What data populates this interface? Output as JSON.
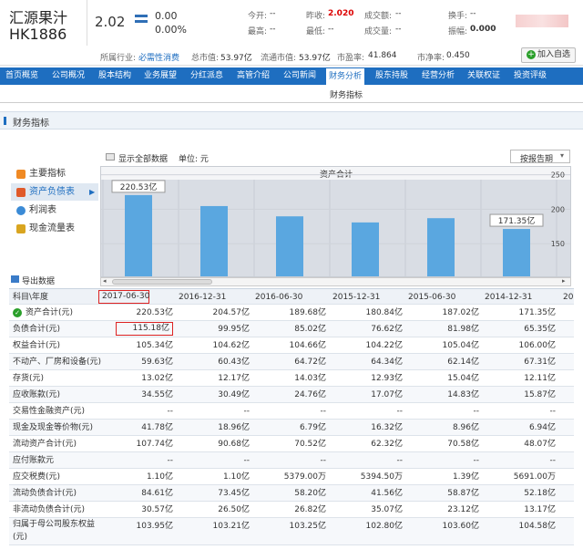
{
  "stock": {
    "name": "汇源果汁",
    "code": "HK1886",
    "price": "2.02",
    "change": "0.00",
    "change_pct": "0.00%"
  },
  "quote": [
    {
      "label": "今开:",
      "value": "--"
    },
    {
      "label": "昨收:",
      "value": "2.020"
    },
    {
      "label": "成交额:",
      "value": "--"
    },
    {
      "label": "换手:",
      "value": "--"
    },
    {
      "label": "最高:",
      "value": "--"
    },
    {
      "label": "最低:",
      "value": "--"
    },
    {
      "label": "成交量:",
      "value": "--"
    },
    {
      "label": "振幅:",
      "value": "0.000"
    }
  ],
  "sub": [
    {
      "label": "所属行业:",
      "value": "必需性消费"
    },
    {
      "label": "总市值:",
      "value": "53.97亿"
    },
    {
      "label": "流通市值:",
      "value": "53.97亿"
    },
    {
      "label": "市盈率:",
      "value": "41.864"
    },
    {
      "label": "市净率:",
      "value": "0.450"
    }
  ],
  "add_button": "加入自选",
  "nav": [
    "首页概览",
    "公司概况",
    "股本结构",
    "业务展望",
    "分红派息",
    "高管介绍",
    "公司新闻",
    "财务分析",
    "股东持股",
    "经营分析",
    "关联权证",
    "投资评级"
  ],
  "subnav": "财务指标",
  "section_title": "财务指标",
  "toolbar": {
    "show_all": "显示全部数据",
    "unit": "单位: 元",
    "period_select": "按报告期"
  },
  "left_menu": [
    "主要指标",
    "资产负债表",
    "利润表",
    "现金流量表"
  ],
  "export": "导出数据",
  "chart_data": {
    "type": "bar",
    "title": "资产合计",
    "categories": [
      "2017-06-30",
      "2016-12-31",
      "2016-06-30",
      "2015-12-31",
      "2015-06-30",
      "2014-12-31"
    ],
    "values": [
      220.53,
      204.57,
      189.68,
      180.84,
      187.02,
      171.35
    ],
    "labels": [
      "220.53亿",
      "",
      "",
      "",
      "",
      "171.35亿"
    ],
    "yticks": [
      "250",
      "200",
      "150"
    ],
    "ylim": [
      100,
      260
    ],
    "color": "#5aa7e0"
  },
  "table": {
    "header": [
      "科目\\年度",
      "2017-06-30",
      "2016-12-31",
      "2016-06-30",
      "2015-12-31",
      "2015-06-30",
      "2014-12-31",
      "20"
    ],
    "rows": [
      [
        "资产合计(元)",
        "220.53亿",
        "204.57亿",
        "189.68亿",
        "180.84亿",
        "187.02亿",
        "171.35亿"
      ],
      [
        "负债合计(元)",
        "115.18亿",
        "99.95亿",
        "85.02亿",
        "76.62亿",
        "81.98亿",
        "65.35亿"
      ],
      [
        "权益合计(元)",
        "105.34亿",
        "104.62亿",
        "104.66亿",
        "104.22亿",
        "105.04亿",
        "106.00亿"
      ],
      [
        "不动产、厂房和设备(元)",
        "59.63亿",
        "60.43亿",
        "64.72亿",
        "64.34亿",
        "62.14亿",
        "67.31亿"
      ],
      [
        "存货(元)",
        "13.02亿",
        "12.17亿",
        "14.03亿",
        "12.93亿",
        "15.04亿",
        "12.11亿"
      ],
      [
        "应收账款(元)",
        "34.55亿",
        "30.49亿",
        "24.76亿",
        "17.07亿",
        "14.83亿",
        "15.87亿"
      ],
      [
        "交易性金融资产(元)",
        "--",
        "--",
        "--",
        "--",
        "--",
        "--"
      ],
      [
        "现金及现金等价物(元)",
        "41.78亿",
        "18.96亿",
        "6.79亿",
        "16.32亿",
        "8.96亿",
        "6.94亿"
      ],
      [
        "流动资产合计(元)",
        "107.74亿",
        "90.68亿",
        "70.52亿",
        "62.32亿",
        "70.58亿",
        "48.07亿"
      ],
      [
        "应付账款元",
        "--",
        "--",
        "--",
        "--",
        "--",
        "--"
      ],
      [
        "应交税费(元)",
        "1.10亿",
        "1.10亿",
        "5379.00万",
        "5394.50万",
        "1.39亿",
        "5691.00万"
      ],
      [
        "流动负债合计(元)",
        "84.61亿",
        "73.45亿",
        "58.20亿",
        "41.56亿",
        "58.87亿",
        "52.18亿"
      ],
      [
        "非流动负债合计(元)",
        "30.57亿",
        "26.50亿",
        "26.82亿",
        "35.07亿",
        "23.12亿",
        "13.17亿"
      ],
      [
        "归属于母公司股东权益(元)",
        "103.95亿",
        "103.21亿",
        "103.25亿",
        "102.80亿",
        "103.60亿",
        "104.58亿"
      ]
    ]
  }
}
